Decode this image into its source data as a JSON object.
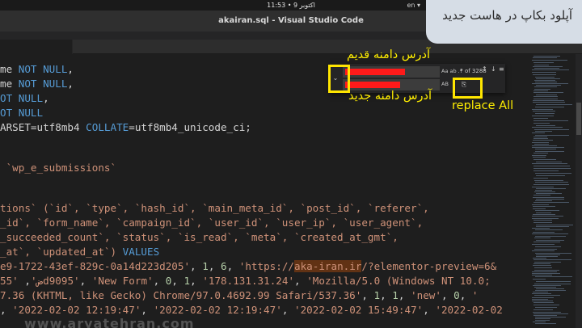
{
  "os_bar": {
    "clock": "11:53 • 9 اکتوبر",
    "tray": "en ▾"
  },
  "window": {
    "title": "akairan.sql - Visual Studio Code"
  },
  "caption": "آپلود بکاپ در هاست جدید",
  "find_widget": {
    "match_count": "? of 3288",
    "find_options": "Aa  ab  .*",
    "replace_options": "AB",
    "prev_label": "↑",
    "next_label": "↓",
    "selection_label": "≡",
    "toggle_label": "⌄",
    "replace_all_icon": "⎘"
  },
  "annotations": {
    "old_domain": "آدرس دامنه قدیم",
    "new_domain": "آدرس دامنه جدید",
    "replace_all": "replace All"
  },
  "code": {
    "line1": {
      "a": "me ",
      "kw": "NOT NULL",
      "b": ","
    },
    "line2": {
      "a": "me ",
      "kw": "NOT NULL",
      "b": ","
    },
    "line3": {
      "a": "",
      "kw": "OT NULL",
      "b": ","
    },
    "line4": {
      "a": "",
      "kw": "OT NULL",
      "b": ""
    },
    "line5": {
      "a": "ARSET=utf8mb4 ",
      "kw": "COLLATE",
      "b": "=utf8mb4_unicode_ci;"
    },
    "line6": {
      "a": " `wp_e_submissions`"
    },
    "line7": {
      "a": "tions` (`id`, `type`, `hash_id`, `main_meta_id`, `post_id`, `referer`,"
    },
    "line8": {
      "a": "_id`, `form_name`, `campaign_id`, `user_id`, `user_ip`, `user_agent`,"
    },
    "line9": {
      "a": "_succeeded_count`, `status`, `is_read`, `meta`, `created_at_gmt`,"
    },
    "line10": {
      "a": "_at`, `updated_at`) ",
      "kw": "VALUES"
    },
    "line11": {
      "s1": "e9-1722-43ef-829c-0a14d223d205'",
      "t1": ", ",
      "n1": "1",
      "t2": ", ",
      "n2": "6",
      "t3": ", ",
      "s2": "'https://",
      "hl": "aka-iran.ir",
      "s3": "/?elementor-preview=6&"
    },
    "line12": {
      "s1": "ض'",
      "t1": ", ",
      "s2": "'55d9095'",
      "t2": ", ",
      "s3": "'New Form'",
      "t3": ", ",
      "n1": "0",
      "t4": ", ",
      "n2": "1",
      "t5": ", ",
      "s4": "'178.131.31.24'",
      "t6": ", ",
      "s5": "'Mozilla/5.0 (Windows NT 10.0;"
    },
    "line13": {
      "s1": "7.36 (KHTML, like Gecko) Chrome/97.0.4692.99 Safari/537.36'",
      "t1": ", ",
      "n1": "1",
      "t2": ", ",
      "n2": "1",
      "t3": ", ",
      "s2": "'new'",
      "t4": ", ",
      "n3": "0",
      "t5": ", ",
      "s3": "'"
    },
    "line14": {
      "t0": ", ",
      "s1": "'2022-02-02 12:19:47'",
      "t1": ", ",
      "s2": "'2022-02-02 12:19:47'",
      "t2": ", ",
      "s3": "'2022-02-02 15:49:47'",
      "t3": ", ",
      "s4": "'2022-02-02"
    }
  },
  "watermark": "www.aryatehran.com"
}
